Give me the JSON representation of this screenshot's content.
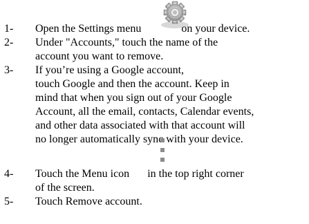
{
  "steps": [
    {
      "number": "1-",
      "lines": [
        "Open the Settings menu",
        "on your device."
      ]
    },
    {
      "number": "2-",
      "lines": [
        "Under \"Accounts,\" touch the name of the",
        "account you want to remove."
      ]
    },
    {
      "number": "3-",
      "lines": [
        "If you’re using a Google account,",
        "touch Google and then the account. Keep in",
        "mind that when you sign out of your Google",
        "Account, all the email, contacts, Calendar events,",
        "and other data associated with that account will",
        "no longer automatically sync with your device."
      ]
    },
    {
      "number": "4-",
      "lines": [
        "Touch the Menu icon",
        "in the top right corner",
        "of the screen."
      ]
    },
    {
      "number": "5-",
      "lines": [
        "Touch Remove account."
      ]
    }
  ],
  "icons": {
    "settings": "settings-gear-icon",
    "menu": "overflow-menu-icon"
  }
}
